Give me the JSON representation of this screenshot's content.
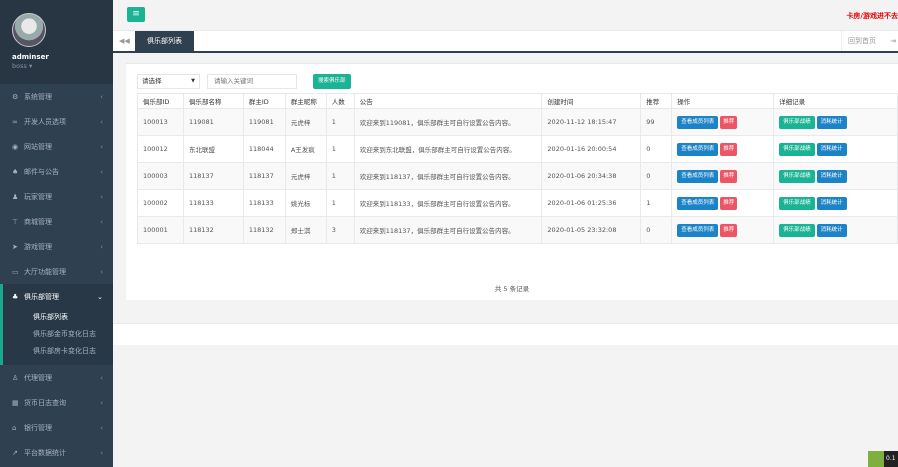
{
  "sidebar": {
    "user_name": "adminser",
    "user_role": "boss ▾",
    "items": [
      {
        "label": "系统管理",
        "icon": "⚙",
        "icon_name": "gears-icon"
      },
      {
        "label": "开发人员选项",
        "icon": "∞",
        "icon_name": "infinity-icon"
      },
      {
        "label": "网站管理",
        "icon": "◉",
        "icon_name": "globe-icon"
      },
      {
        "label": "邮件与公告",
        "icon": "♠",
        "icon_name": "bell-icon"
      },
      {
        "label": "玩家管理",
        "icon": "♟",
        "icon_name": "user-icon"
      },
      {
        "label": "商城管理",
        "icon": "⊤",
        "icon_name": "cart-icon"
      },
      {
        "label": "游戏管理",
        "icon": "➤",
        "icon_name": "send-icon"
      },
      {
        "label": "大厅功能管理",
        "icon": "▭",
        "icon_name": "monitor-icon"
      },
      {
        "label": "俱乐部管理",
        "icon": "♣",
        "icon_name": "group-icon"
      },
      {
        "label": "代理管理",
        "icon": "♙",
        "icon_name": "agent-icon"
      },
      {
        "label": "货币日志查询",
        "icon": "▦",
        "icon_name": "calendar-icon"
      },
      {
        "label": "银行管理",
        "icon": "⌂",
        "icon_name": "bank-icon"
      },
      {
        "label": "平台数据统计",
        "icon": "↗",
        "icon_name": "line-chart-icon"
      }
    ],
    "club_subitems": [
      "俱乐部列表",
      "俱乐部金币变化日志",
      "俱乐部房卡变化日志"
    ]
  },
  "topbar": {
    "menu_icon": "≡",
    "notice": "卡房/游戏进不去"
  },
  "tabs": {
    "back_icon": "◀◀",
    "active_tab": "俱乐部列表",
    "close_all": "回到首页",
    "exit_icon": "⇥"
  },
  "search": {
    "select_value": "请选择",
    "keyword_placeholder": "请输入关键词",
    "search_button": "搜索俱乐部"
  },
  "table": {
    "headers": [
      "俱乐部ID",
      "俱乐部名称",
      "群主ID",
      "群主昵称",
      "人数",
      "公告",
      "创建时间",
      "推荐",
      "操作",
      "详细记录"
    ],
    "rows": [
      {
        "club_id": "100013",
        "name": "119081",
        "owner_id": "119081",
        "owner_nick": "元虎梓",
        "members": "1",
        "notice": "欢迎来到119081，俱乐部群主可自行设置公告内容。",
        "created": "2020-11-12 18:15:47",
        "recommend": "99"
      },
      {
        "club_id": "100012",
        "name": "东北联盟",
        "owner_id": "118044",
        "owner_nick": "A王发疯",
        "members": "1",
        "notice": "欢迎来到东北联盟，俱乐部群主可自行设置公告内容。",
        "created": "2020-01-16 20:00:54",
        "recommend": "0"
      },
      {
        "club_id": "100003",
        "name": "118137",
        "owner_id": "118137",
        "owner_nick": "元虎梓",
        "members": "1",
        "notice": "欢迎来到118137，俱乐部群主可自行设置公告内容。",
        "created": "2020-01-06 20:34:38",
        "recommend": "0"
      },
      {
        "club_id": "100002",
        "name": "118133",
        "owner_id": "118133",
        "owner_nick": "姚光标",
        "members": "1",
        "notice": "欢迎来到118133，俱乐部群主可自行设置公告内容。",
        "created": "2020-01-06 01:25:36",
        "recommend": "1"
      },
      {
        "club_id": "100001",
        "name": "118132",
        "owner_id": "118132",
        "owner_nick": "郑士淇",
        "members": "3",
        "notice": "欢迎来到118137，俱乐部群主可自行设置公告内容。",
        "created": "2020-01-05 23:32:08",
        "recommend": "0"
      }
    ],
    "btn_members": "查看成员列表",
    "btn_recommend": "推荐",
    "btn_battle": "俱乐部战绩",
    "btn_stats": "消耗统计"
  },
  "footer": {
    "count_text": "共 5 条记录"
  },
  "badge": {
    "text": "0.1"
  }
}
